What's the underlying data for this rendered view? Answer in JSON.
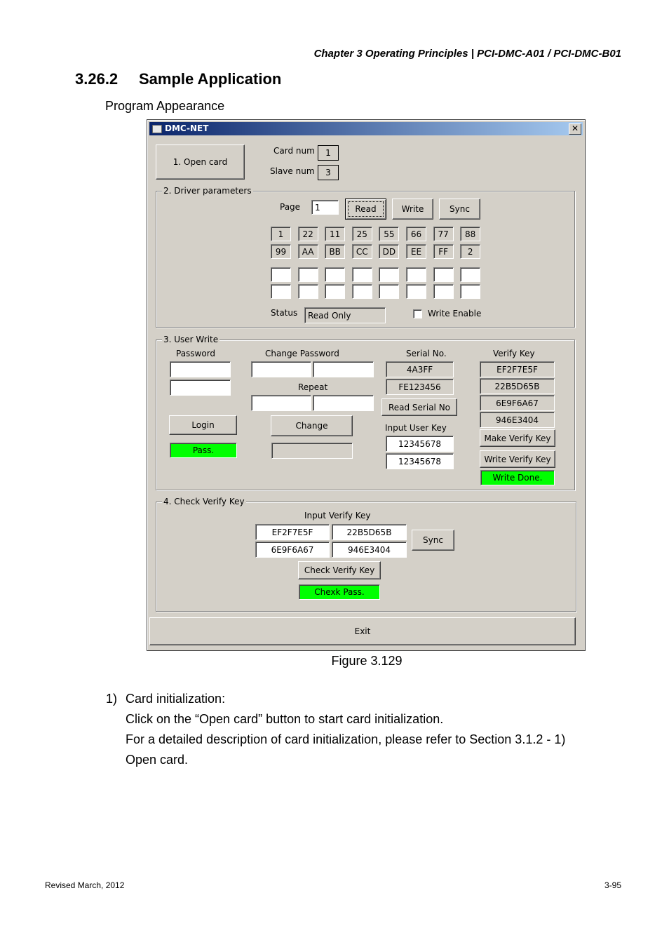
{
  "page": {
    "header": "Chapter 3  Operating  Principles  |  PCI-DMC-A01  /  PCI-DMC-B01",
    "section_number": "3.26.2",
    "section_title": "Sample Application",
    "subheading": "Program Appearance",
    "figure_caption": "Figure 3.129",
    "steps": [
      {
        "label": "1)",
        "title": "Card initialization:",
        "lines": [
          "Click on the “Open card” button to start card initialization.",
          "For a detailed description of card initialization, please refer to Section 3.1.2 - 1)",
          "Open card."
        ]
      }
    ],
    "footer_left": "Revised March, 2012",
    "footer_right": "3-95"
  },
  "window": {
    "title": "DMC-NET",
    "close_glyph": "✕",
    "open_card_label": "1. Open card",
    "card_num_label": "Card num",
    "card_num_value": "1",
    "slave_num_label": "Slave num",
    "slave_num_value": "3",
    "driver": {
      "group_label": "2. Driver parameters",
      "page_label": "Page",
      "page_value": "1",
      "read_label": "Read",
      "write_label": "Write",
      "sync_label": "Sync",
      "row1": [
        "1",
        "22",
        "11",
        "25",
        "55",
        "66",
        "77",
        "88"
      ],
      "row2": [
        "99",
        "AA",
        "BB",
        "CC",
        "DD",
        "EE",
        "FF",
        "2"
      ],
      "row3": [
        "",
        "",
        "",
        "",
        "",
        "",
        "",
        ""
      ],
      "row4": [
        "",
        "",
        "",
        "",
        "",
        "",
        "",
        ""
      ],
      "status_label": "Status",
      "status_value": "Read Only",
      "write_enable_label": "Write Enable"
    },
    "user_write": {
      "group_label": "3. User Write",
      "password_label": "Password",
      "change_password_label": "Change Password",
      "repeat_label": "Repeat",
      "serial_label": "Serial No.",
      "serial_values": [
        "4A3FF",
        "FE123456"
      ],
      "read_serial_label": "Read Serial No",
      "input_user_key_label": "Input User Key",
      "user_key_values": [
        "12345678",
        "12345678"
      ],
      "verify_key_label": "Verify Key",
      "verify_key_values": [
        "EF2F7E5F",
        "22B5D65B",
        "6E9F6A67",
        "946E3404"
      ],
      "make_verify_label": "Make Verify Key",
      "write_verify_label": "Write Verify Key",
      "write_status": "Write Done.",
      "login_label": "Login",
      "login_status": "Pass.",
      "change_label": "Change"
    },
    "check": {
      "group_label": "4. Check Verify Key",
      "input_label": "Input Verify Key",
      "keys": [
        "EF2F7E5F",
        "22B5D65B",
        "6E9F6A67",
        "946E3404"
      ],
      "sync_label": "Sync",
      "check_label": "Check Verify Key",
      "check_status": "Chexk Pass."
    },
    "exit_label": "Exit",
    "colors": {
      "title_start": "#0a246a",
      "title_end": "#a6caf0",
      "face": "#d4d0c8",
      "status_green": "#00ff00"
    }
  }
}
